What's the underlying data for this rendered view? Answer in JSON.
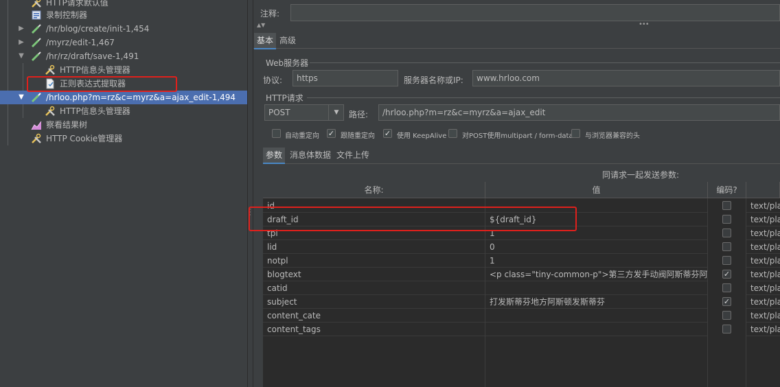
{
  "tree": {
    "items": [
      {
        "label": "HTTP请求默认值",
        "icon": "tools-icon"
      },
      {
        "label": "录制控制器",
        "icon": "recorder-icon"
      },
      {
        "label": "/hr/blog/create/init-1,454",
        "icon": "pipette-icon"
      },
      {
        "label": "/myrz/edit-1,467",
        "icon": "pipette-icon"
      },
      {
        "label": "/hr/rz/draft/save-1,491",
        "icon": "pipette-icon"
      },
      {
        "label": "HTTP信息头管理器",
        "icon": "tools-icon"
      },
      {
        "label": "正则表达式提取器",
        "icon": "document-icon"
      },
      {
        "label": "/hrloo.php?m=rz&c=myrz&a=ajax_edit-1,494",
        "icon": "pipette-icon"
      },
      {
        "label": "HTTP信息头管理器",
        "icon": "tools-icon"
      },
      {
        "label": "察看结果树",
        "icon": "chart-icon"
      },
      {
        "label": "HTTP Cookie管理器",
        "icon": "tools-icon"
      }
    ]
  },
  "comment": {
    "label": "注释:",
    "value": ""
  },
  "tabs": {
    "basic": "基本",
    "advanced": "高级"
  },
  "web_server": {
    "title": "Web服务器",
    "protocol_label": "协议:",
    "protocol_value": "https",
    "server_label": "服务器名称或IP:",
    "server_value": "www.hrloo.com"
  },
  "http_request": {
    "title": "HTTP请求",
    "method": "POST",
    "path_label": "路径:",
    "path_value": "/hrloo.php?m=rz&c=myrz&a=ajax_edit"
  },
  "options": [
    {
      "label": "自动重定向",
      "checked": false
    },
    {
      "label": "跟随重定向",
      "checked": true
    },
    {
      "label": "使用 KeepAlive",
      "checked": true
    },
    {
      "label": "对POST使用multipart / form-data",
      "checked": false
    },
    {
      "label": "与浏览器兼容的头",
      "checked": false
    }
  ],
  "sub_tabs": {
    "params": "参数",
    "body": "消息体数据",
    "files": "文件上传"
  },
  "params_title": "同请求一起发送参数:",
  "table": {
    "headers": {
      "name": "名称:",
      "value": "值",
      "encode": "编码?"
    },
    "rows": [
      {
        "name": "id",
        "value": "",
        "encode": false,
        "type": "text/plain"
      },
      {
        "name": "draft_id",
        "value": "${draft_id}",
        "encode": false,
        "type": "text/plain"
      },
      {
        "name": "tpl",
        "value": "1",
        "encode": false,
        "type": "text/plain"
      },
      {
        "name": "lid",
        "value": "0",
        "encode": false,
        "type": "text/plain"
      },
      {
        "name": "notpl",
        "value": "1",
        "encode": false,
        "type": "text/plain"
      },
      {
        "name": "blogtext",
        "value": "<p class=\"tiny-common-p\">第三方发手动阀阿斯蒂芬阿...",
        "encode": true,
        "type": "text/plain"
      },
      {
        "name": "catid",
        "value": "",
        "encode": false,
        "type": "text/plain"
      },
      {
        "name": "subject",
        "value": "打发斯蒂芬地方阿斯顿发斯蒂芬",
        "encode": true,
        "type": "text/plain"
      },
      {
        "name": "content_cate",
        "value": "",
        "encode": false,
        "type": "text/plain"
      },
      {
        "name": "content_tags",
        "value": "",
        "encode": false,
        "type": "text/plain"
      }
    ]
  },
  "colors": {
    "selection": "#4b6eaf",
    "highlight": "#e0201c",
    "background": "#3c3f41"
  }
}
